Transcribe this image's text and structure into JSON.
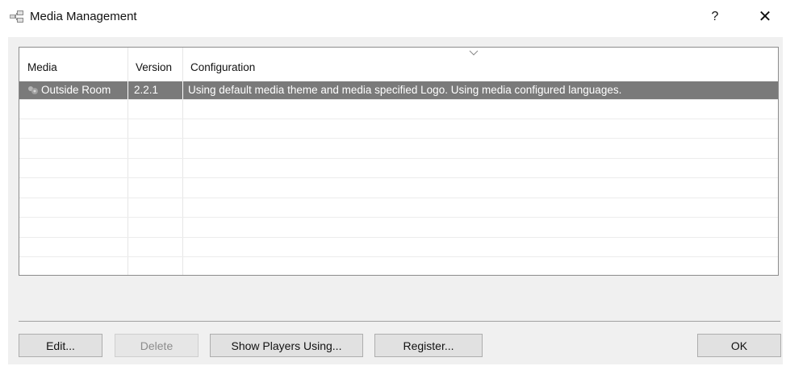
{
  "window": {
    "title": "Media Management",
    "help_label": "?",
    "close_label": "✕"
  },
  "list": {
    "columns": [
      "Media",
      "Version",
      "Configuration"
    ],
    "rows": [
      {
        "media": "Outside Room",
        "version": "2.2.1",
        "configuration": "Using default media theme and media specified Logo. Using media configured languages.",
        "selected": true
      }
    ]
  },
  "buttons": {
    "edit": "Edit...",
    "delete": "Delete",
    "show_players": "Show Players Using...",
    "register": "Register...",
    "ok": "OK"
  },
  "colors": {
    "selection": "#7a7a7a",
    "dialog_bg": "#f0f0f0"
  }
}
